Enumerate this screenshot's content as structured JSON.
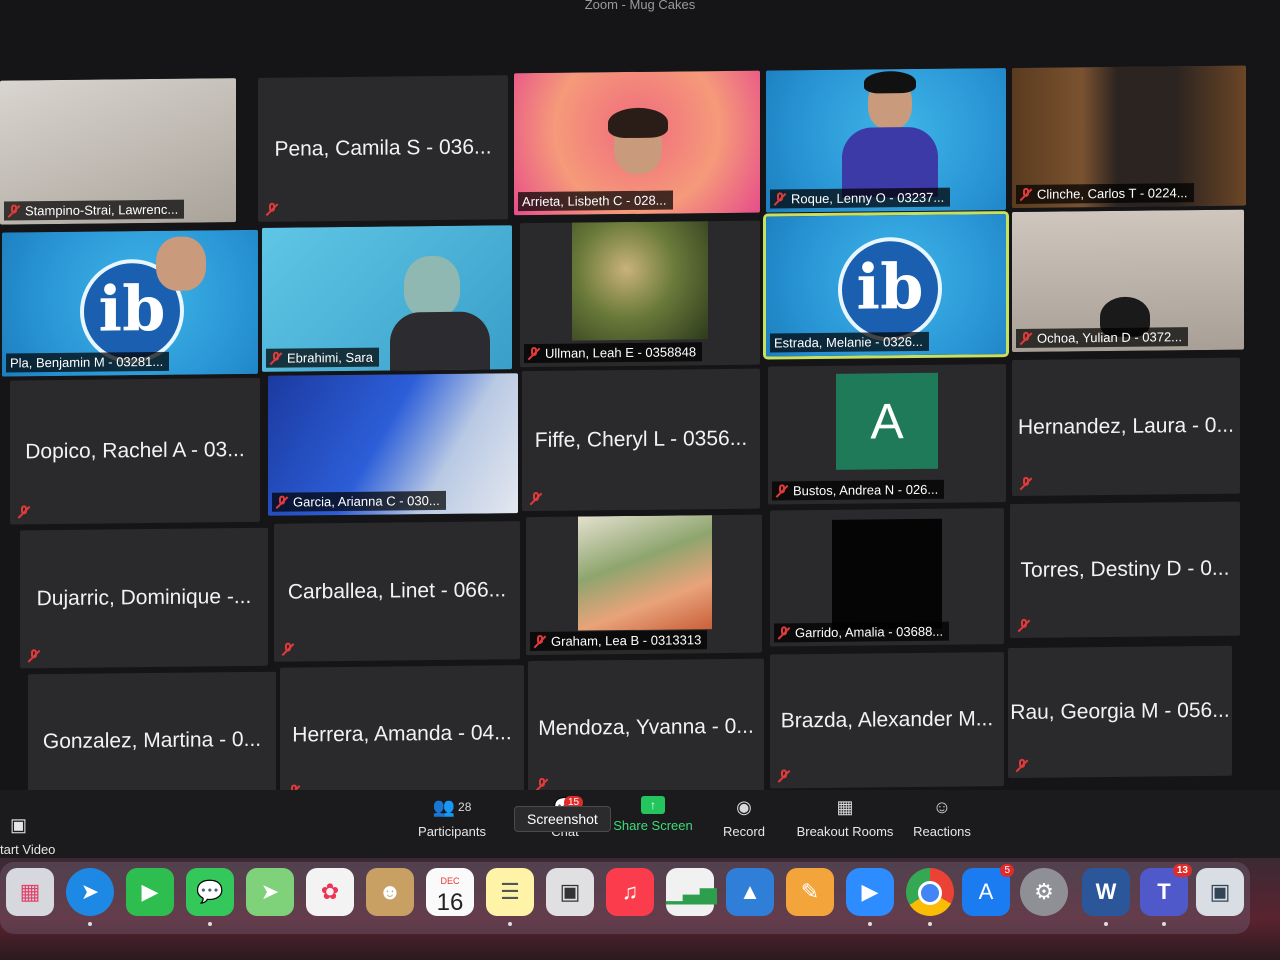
{
  "window": {
    "title": "Zoom - Mug Cakes"
  },
  "participants": [
    {
      "name": "Stampino-Strai, Lawrenc...",
      "muted": true,
      "mode": "video",
      "label_style": "bar"
    },
    {
      "name": "Pena, Camila S - 036...",
      "muted": true,
      "mode": "name",
      "label_style": "big"
    },
    {
      "name": "Arrieta, Lisbeth C - 028...",
      "muted": false,
      "mode": "video",
      "label_style": "bar"
    },
    {
      "name": "Roque, Lenny O - 03237...",
      "muted": true,
      "mode": "video",
      "label_style": "bar"
    },
    {
      "name": "Clinche, Carlos T - 0224...",
      "muted": true,
      "mode": "video",
      "label_style": "bar"
    },
    {
      "name": "Pla, Benjamin M - 03281...",
      "muted": false,
      "mode": "video",
      "label_style": "bar"
    },
    {
      "name": "Ebrahimi, Sara",
      "muted": true,
      "mode": "video",
      "label_style": "bar"
    },
    {
      "name": "Ullman, Leah E - 0358848",
      "muted": true,
      "mode": "video",
      "label_style": "bar"
    },
    {
      "name": "Estrada, Melanie - 0326...",
      "muted": false,
      "mode": "video",
      "label_style": "bar",
      "active": true
    },
    {
      "name": "Ochoa, Yulian D - 0372...",
      "muted": true,
      "mode": "video",
      "label_style": "bar"
    },
    {
      "name": "Dopico, Rachel A - 03...",
      "muted": true,
      "mode": "name",
      "label_style": "big"
    },
    {
      "name": "Garcia, Arianna C - 030...",
      "muted": true,
      "mode": "video",
      "label_style": "bar"
    },
    {
      "name": "Fiffe, Cheryl L - 0356...",
      "muted": true,
      "mode": "name",
      "label_style": "big"
    },
    {
      "name": "Bustos, Andrea N - 026...",
      "muted": true,
      "mode": "avatar",
      "avatar_letter": "A",
      "label_style": "bar"
    },
    {
      "name": "Hernandez, Laura - 0...",
      "muted": true,
      "mode": "name",
      "label_style": "big"
    },
    {
      "name": "Dujarric, Dominique -...",
      "muted": true,
      "mode": "name",
      "label_style": "big"
    },
    {
      "name": "Carballea, Linet - 066...",
      "muted": true,
      "mode": "name",
      "label_style": "big"
    },
    {
      "name": "Graham, Lea B - 0313313",
      "muted": true,
      "mode": "video",
      "label_style": "bar"
    },
    {
      "name": "Garrido, Amalia - 03688...",
      "muted": true,
      "mode": "black",
      "label_style": "bar"
    },
    {
      "name": "Torres, Destiny D - 0...",
      "muted": true,
      "mode": "name",
      "label_style": "big"
    },
    {
      "name": "Gonzalez, Martina - 0...",
      "muted": true,
      "mode": "name",
      "label_style": "big"
    },
    {
      "name": "Herrera, Amanda - 04...",
      "muted": true,
      "mode": "name",
      "label_style": "big"
    },
    {
      "name": "Mendoza, Yvanna - 0...",
      "muted": true,
      "mode": "name",
      "label_style": "big"
    },
    {
      "name": "Brazda, Alexander M...",
      "muted": true,
      "mode": "name",
      "label_style": "big"
    },
    {
      "name": "Rau, Georgia M - 056...",
      "muted": true,
      "mode": "name",
      "label_style": "big"
    }
  ],
  "toolbar": {
    "start_video": "tart Video",
    "participants_label": "Participants",
    "participants_count": "28",
    "chat_label": "Chat",
    "chat_badge": "15",
    "share_label": "Share Screen",
    "record_label": "Record",
    "breakout_label": "Breakout Rooms",
    "reactions_label": "Reactions",
    "tooltip": "Screenshot"
  },
  "dock": {
    "calendar_month": "DEC",
    "calendar_day": "16",
    "appstore_badge": "5",
    "teams_badge": "13",
    "word_letter": "W",
    "teams_letter": "T",
    "avatar_letter": "A"
  },
  "colors": {
    "tile_bg": "#2a2a2c",
    "muted_icon": "#e23a3a",
    "active_speaker": "#c8e060",
    "share_green": "#23c55e",
    "ib_blue": "#2a96d6"
  }
}
